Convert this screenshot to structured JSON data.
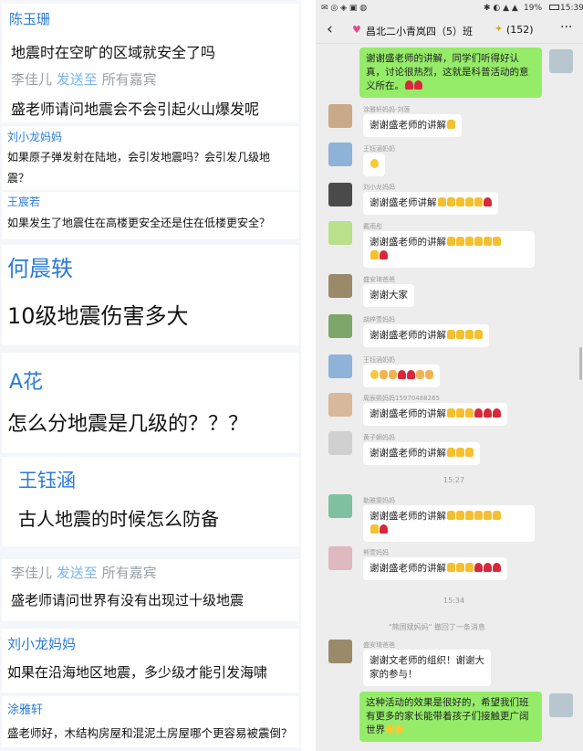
{
  "left_panel": {
    "items": [
      {
        "name": "陈玉珊",
        "message": "地震时在空旷的区域就安全了吗"
      },
      {
        "sender": "李佳儿",
        "send_to": "发送至",
        "target": "所有嘉宾",
        "message": "盛老师请问地震会不会引起火山爆发呢"
      },
      {
        "name": "刘小龙妈妈",
        "message": "如果原子弹发射在陆地，会引发地震吗？会引发几级地",
        "message2": "震？"
      },
      {
        "name": "王宸若",
        "message": "如果发生了地震住在高楼更安全还是住在低楼更安全？"
      },
      {
        "name": "何晨轶",
        "message": "10级地震伤害多大"
      },
      {
        "name": "A花",
        "message": "怎么分地震是几级的？？？"
      },
      {
        "name": "王钰涵",
        "message": "古人地震的时候怎么防备"
      },
      {
        "sender": "李佳儿",
        "send_to": "发送至",
        "target": "所有嘉宾",
        "message": "盛老师请问世界有没有出现过十级地震"
      },
      {
        "name": "刘小龙妈妈",
        "message": "如果在沿海地区地震，多少级才能引发海啸"
      },
      {
        "name": "涂雅轩",
        "message": "盛老师好，木结构房屋和混泥土房屋哪个更容易被震倒？"
      }
    ],
    "partial_top": "何晨轶"
  },
  "status_bar": {
    "battery": "19%",
    "time": "15:39"
  },
  "chat": {
    "title": "昌北二小青岚四（5）班",
    "count": "(152)",
    "back_icon": "back-arrow-icon",
    "more_icon": "ellipsis-icon",
    "first_message": "谢谢盛老师的讲解，同学们听得好认真，讨论很热烈，这就是科普活动的意义所在。",
    "messages": [
      {
        "nick": "涂雅轩妈妈-刘莲",
        "text": "谢谢盛老师的讲解",
        "emoji": [
          "thumb"
        ]
      },
      {
        "nick": "王钰涵奶奶",
        "text": "",
        "emoji": [
          "smile"
        ]
      },
      {
        "nick": "刘小龙妈妈",
        "text": "谢谢盛老师讲解",
        "emoji": [
          "thumb",
          "thumb",
          "thumb",
          "thumb",
          "thumb",
          "rose"
        ]
      },
      {
        "nick": "戴雨彤",
        "text": "谢谢盛老师的讲解",
        "emoji": [
          "thumb",
          "thumb",
          "thumb",
          "thumb",
          "thumb",
          "thumb"
        ],
        "emoji2": [
          "thumb",
          "rose"
        ]
      },
      {
        "nick": "盛安琦爸爸",
        "text": "谢谢大家",
        "emoji": []
      },
      {
        "nick": "胡梓萱妈妈",
        "text": "谢谢盛老师的讲解",
        "emoji": [
          "thumb",
          "thumb",
          "thumb",
          "thumb"
        ]
      },
      {
        "nick": "王钰涵奶奶",
        "text": "",
        "emoji": [
          "smile",
          "clap",
          "clap",
          "rose",
          "rose",
          "clap",
          "clap"
        ]
      },
      {
        "nick": "周辰熙妈妈15970488265",
        "text": "谢谢盛老师的讲解",
        "emoji": [
          "thumb",
          "thumb",
          "thumb",
          "rose",
          "rose",
          "rose"
        ]
      },
      {
        "nick": "黄子娴妈妈",
        "text": "谢谢盛老师的讲解",
        "emoji": [
          "thumb",
          "thumb",
          "thumb"
        ]
      }
    ],
    "time1": "15:27",
    "messages2": [
      {
        "nick": "勒雅雯妈妈",
        "text": "谢谢盛老师的讲解",
        "emoji": [
          "thumb",
          "thumb",
          "thumb",
          "thumb",
          "thumb",
          "thumb"
        ],
        "emoji2": [
          "thumb",
          "rose"
        ]
      },
      {
        "nick": "熊萱妈妈",
        "text": "谢谢盛老师的讲解",
        "emoji": [
          "thumb",
          "thumb",
          "thumb",
          "rose",
          "rose",
          "rose"
        ]
      }
    ],
    "time2": "15:34",
    "recall_notice": "\"熊国斌妈妈\" 撤回了一条消息",
    "last_other": {
      "nick": "盛安琦爸爸",
      "text": "谢谢文老师的组织！谢谢大家的参与！"
    },
    "last_me": "这种活动的效果是很好的，希望我们班有更多的家长能带着孩子们接触更广阔世界"
  },
  "colors": {
    "accent_blue": "#2b7bd6",
    "bubble_green": "#95ec69",
    "chat_bg": "#ededed"
  }
}
